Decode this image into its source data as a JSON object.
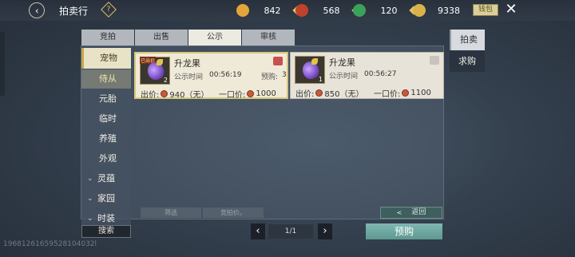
{
  "topbar": {
    "title": "拍卖行",
    "help_label": "?",
    "resources": [
      {
        "icon": "gold-medal-icon",
        "value": "842",
        "color": "#e3a53a"
      },
      {
        "icon": "red-orb-icon",
        "value": "568",
        "color": "#c0422a"
      },
      {
        "icon": "jade-dragon-icon",
        "value": "120",
        "color": "#3aa35a"
      },
      {
        "icon": "golden-leaf-icon",
        "value": "9338",
        "color": "#d9b24a"
      }
    ],
    "settings_label": "钱包",
    "close_label": "✕"
  },
  "tabs": [
    "竞拍",
    "出售",
    "公示",
    "审核"
  ],
  "active_tab": "公示",
  "categories": {
    "top": "宠物",
    "subs": [
      "侍从",
      "元胎",
      "临时",
      "养殖",
      "外观"
    ],
    "collapsed": [
      "灵蕴",
      "家园",
      "时装"
    ]
  },
  "cards": [
    {
      "name": "升龙果",
      "tag": "已出价",
      "qty": "2",
      "pub_label": "公示时间",
      "pub_time": "00:56:19",
      "presale_label": "预购:",
      "presale_count": "3",
      "price_label": "出价:",
      "price": "940（无）",
      "buyout_label": "一口价:",
      "buyout": "1000",
      "favorited": true
    },
    {
      "name": "升龙果",
      "tag": "",
      "qty": "1",
      "pub_label": "公示时间",
      "pub_time": "00:56:27",
      "presale_label": "",
      "presale_count": "",
      "price_label": "出价:",
      "price": "850（无）",
      "buyout_label": "一口价:",
      "buyout": "1100",
      "favorited": false
    }
  ],
  "filters": {
    "filter_label": "筛选",
    "sort_label": "竞拍价。",
    "return_label": "返回"
  },
  "side_tabs": [
    "拍卖",
    "求购"
  ],
  "footer": {
    "search_label": "搜索",
    "page": "1/1",
    "presale_button": "预购",
    "uid": "19681261659528104032l"
  }
}
